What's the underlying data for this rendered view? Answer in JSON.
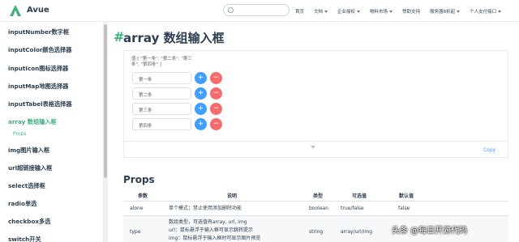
{
  "nav": {
    "logo": "Avue",
    "search_placeholder": "",
    "links": [
      {
        "label": "首页",
        "caret": false
      },
      {
        "label": "文档",
        "caret": true
      },
      {
        "label": "企业授权",
        "caret": true
      },
      {
        "label": "物料市场",
        "caret": true
      },
      {
        "label": "赞助支持",
        "caret": false
      },
      {
        "label": "服务器8折起",
        "caret": true
      },
      {
        "label": "个人支付接口",
        "caret": true
      }
    ]
  },
  "sidebar": {
    "items": [
      "inputNumber数字框",
      "inputColor颜色选择器",
      "inputIcon图标选择器",
      "inputMap地图选择器",
      "inputTabel表格选择器",
      "array 数组输入框",
      "img图片输入框",
      "url超链接输入框",
      "select选择框",
      "radio单选",
      "checkbox多选",
      "switch开关"
    ],
    "sub_item": "Props"
  },
  "page": {
    "hash": "#",
    "title": "array 数组输入框",
    "value_line": "值:[ \"第一条\", \"第二条\", \"第三条\", \"第四条\" ]",
    "rows": [
      "第一条",
      "第二条",
      "第三条",
      "第四条"
    ],
    "plus": "+",
    "minus": "−",
    "copy": "Copy"
  },
  "props": {
    "title": "Props",
    "headers": [
      "参数",
      "说明",
      "类型",
      "可选值",
      "默认值"
    ],
    "rows": [
      {
        "param": "alone",
        "desc": [
          "单个模式；禁止使用添加删除功能"
        ],
        "type": "boolean",
        "options": "true/false",
        "default": "false"
      },
      {
        "param": "type",
        "desc": [
          "数组类型，可选值有array, url, img",
          "url：鼠标悬浮于输入框可显示跳转提示",
          "img：鼠标悬浮于输入框时可显示图片预览"
        ],
        "type": "string",
        "options": "array/url/img",
        "default": ""
      }
    ]
  },
  "watermark": "头条 @每日开源代码",
  "colors": {
    "accent": "#3eaf7c",
    "primary": "#409eff",
    "danger": "#f56c6c",
    "text": "#2c3e50"
  }
}
